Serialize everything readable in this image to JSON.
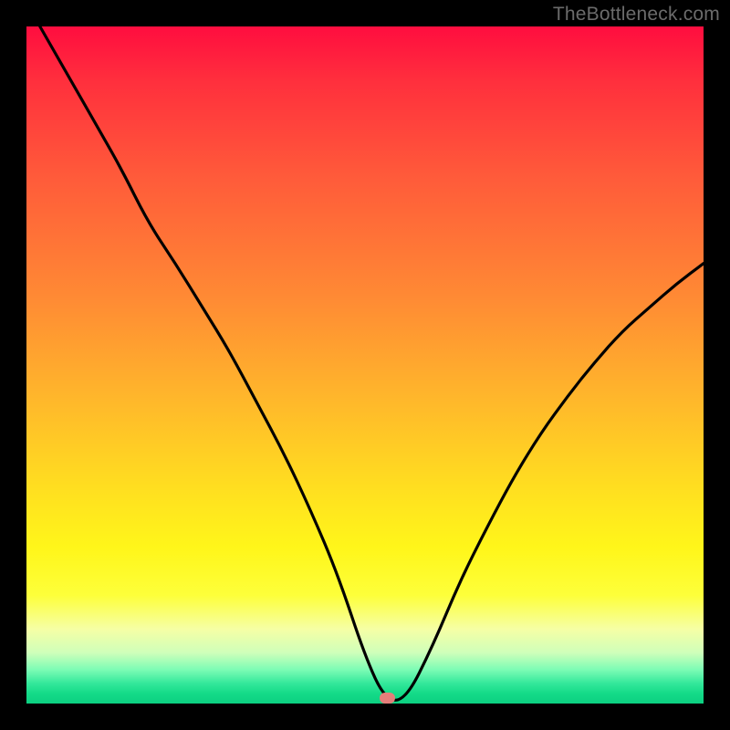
{
  "watermark": "TheBottleneck.com",
  "marker": {
    "x_frac": 0.533,
    "y_frac": 0.992
  },
  "chart_data": {
    "type": "line",
    "title": "",
    "xlabel": "",
    "ylabel": "",
    "xlim": [
      0,
      1
    ],
    "ylim": [
      0,
      1
    ],
    "series": [
      {
        "name": "bottleneck-curve",
        "x": [
          0.02,
          0.06,
          0.1,
          0.14,
          0.18,
          0.22,
          0.26,
          0.3,
          0.34,
          0.38,
          0.42,
          0.46,
          0.5,
          0.53,
          0.56,
          0.6,
          0.64,
          0.68,
          0.72,
          0.76,
          0.8,
          0.84,
          0.88,
          0.92,
          0.96,
          1.0
        ],
        "y": [
          1.0,
          0.93,
          0.86,
          0.79,
          0.71,
          0.65,
          0.585,
          0.52,
          0.445,
          0.37,
          0.285,
          0.19,
          0.07,
          0.005,
          0.005,
          0.085,
          0.18,
          0.26,
          0.335,
          0.4,
          0.455,
          0.505,
          0.55,
          0.585,
          0.62,
          0.65
        ]
      }
    ],
    "gradient_stops": [
      {
        "pos": 0.0,
        "color": "#ff0d3f"
      },
      {
        "pos": 0.4,
        "color": "#ff8a34"
      },
      {
        "pos": 0.7,
        "color": "#ffe020"
      },
      {
        "pos": 0.9,
        "color": "#f6ffa5"
      },
      {
        "pos": 1.0,
        "color": "#0cd081"
      }
    ]
  }
}
